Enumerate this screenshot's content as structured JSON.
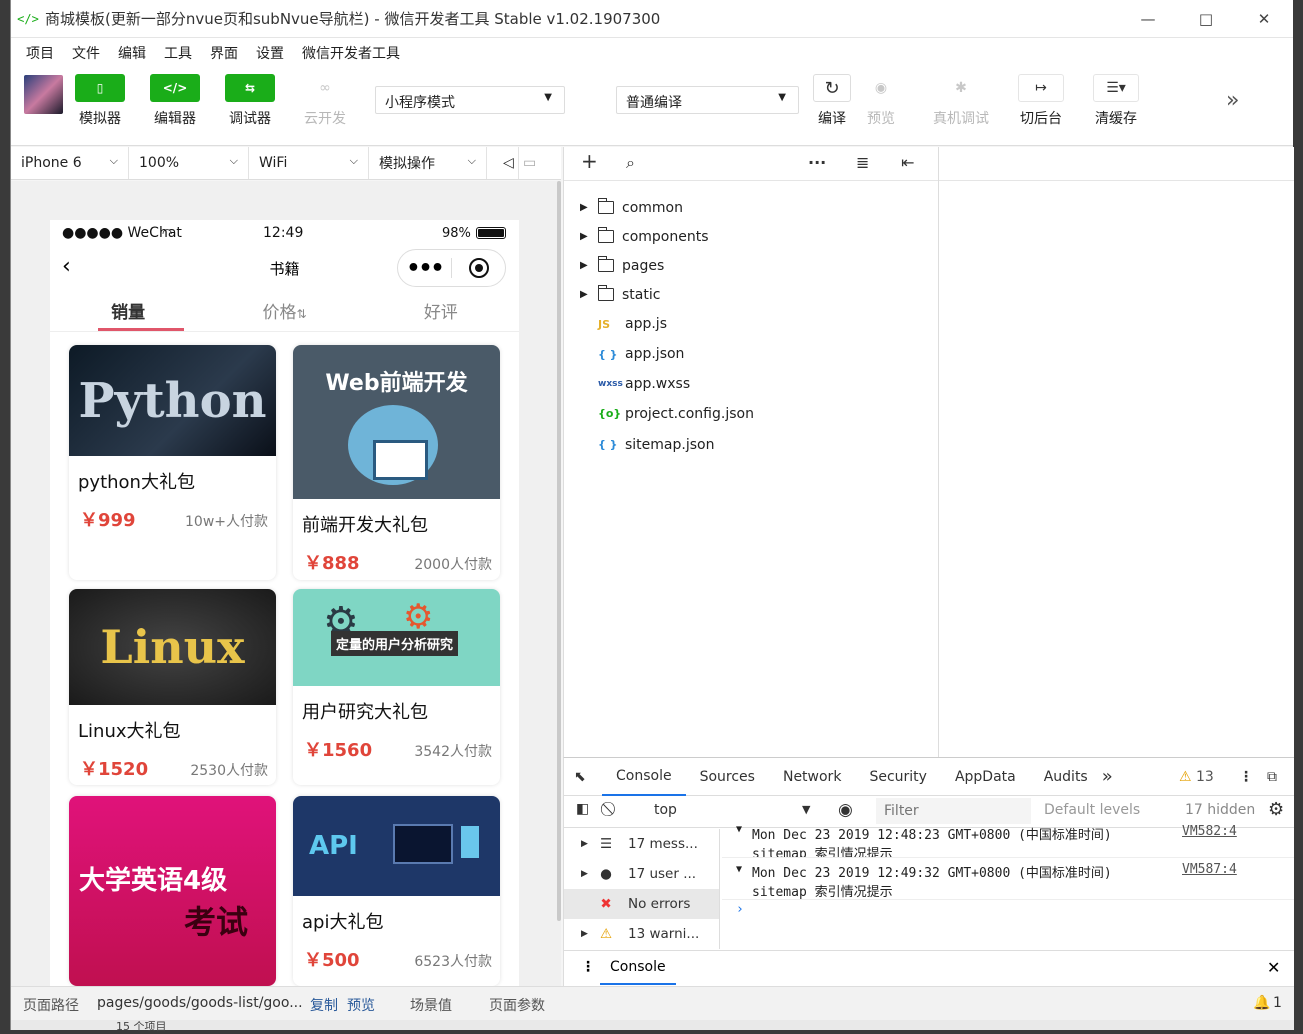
{
  "window": {
    "title": "商城模板(更新一部分nvue页和subNvue导航栏) - 微信开发者工具 Stable v1.02.1907300"
  },
  "menu": [
    "项目",
    "文件",
    "编辑",
    "工具",
    "界面",
    "设置",
    "微信开发者工具"
  ],
  "toolbar": {
    "simulator": "模拟器",
    "editor": "编辑器",
    "debugger": "调试器",
    "cloud": "云开发",
    "mode": "小程序模式",
    "compile_mode": "普通编译",
    "compile": "编译",
    "preview": "预览",
    "remote_debug": "真机调试",
    "background": "切后台",
    "clear_cache": "清缓存"
  },
  "sim": {
    "device": "iPhone 6",
    "zoom": "100%",
    "network": "WiFi",
    "ops": "模拟操作"
  },
  "phone": {
    "carrier": "●●●●● WeChat",
    "time": "12:49",
    "battery": "98%",
    "nav_title": "书籍",
    "tabs": [
      "销量",
      "价格",
      "好评"
    ],
    "products": [
      {
        "name": "python大礼包",
        "price": "￥999",
        "sold": "10w+人付款",
        "img": "Python"
      },
      {
        "name": "前端开发大礼包",
        "price": "￥888",
        "sold": "2000人付款",
        "img": "Web前端开发"
      },
      {
        "name": "Linux大礼包",
        "price": "￥1520",
        "sold": "2530人付款",
        "img": "Linux"
      },
      {
        "name": "用户研究大礼包",
        "price": "￥1560",
        "sold": "3542人付款",
        "img": "定量的用户分析研究"
      },
      {
        "name": "",
        "price": "",
        "sold": "",
        "img": "大学英语4级",
        "img2": "考试"
      },
      {
        "name": "api大礼包",
        "price": "￥500",
        "sold": "6523人付款",
        "img": "API"
      }
    ]
  },
  "files": [
    {
      "name": "common",
      "type": "folder"
    },
    {
      "name": "components",
      "type": "folder"
    },
    {
      "name": "pages",
      "type": "folder"
    },
    {
      "name": "static",
      "type": "folder"
    },
    {
      "name": "app.js",
      "type": "js",
      "badge": "JS"
    },
    {
      "name": "app.json",
      "type": "json",
      "badge": "{ }"
    },
    {
      "name": "app.wxss",
      "type": "wxss",
      "badge": "wxss"
    },
    {
      "name": "project.config.json",
      "type": "config",
      "badge": "{o}"
    },
    {
      "name": "sitemap.json",
      "type": "json",
      "badge": "{ }"
    }
  ],
  "devtools": {
    "tabs": [
      "Console",
      "Sources",
      "Network",
      "Security",
      "AppData",
      "Audits"
    ],
    "warn_count": "13",
    "context": "top",
    "filter_placeholder": "Filter",
    "levels": "Default levels",
    "hidden": "17 hidden",
    "sidebar": [
      "17 mess...",
      "17 user ...",
      "No errors",
      "13 warni..."
    ],
    "logs": [
      {
        "head": "Mon Dec 23 2019 12:48:23 GMT+0800 (中国标准时间)",
        "body": "sitemap 索引情况提示",
        "src": "VM582:4"
      },
      {
        "head": "Mon Dec 23 2019 12:49:32 GMT+0800 (中国标准时间)",
        "body": "sitemap 索引情况提示",
        "src": "VM587:4"
      }
    ],
    "drawer_tab": "Console"
  },
  "bottom": {
    "path_label": "页面路径",
    "path": "pages/goods/goods-list/goo...",
    "copy": "复制",
    "preview": "预览",
    "scene": "场景值",
    "params": "页面参数",
    "notif": "1"
  },
  "taskbar": {
    "text": "15 个项目"
  },
  "colors": {
    "accent": "#1aad19",
    "price": "#e0453a",
    "tab_underline": "#e0566a"
  }
}
